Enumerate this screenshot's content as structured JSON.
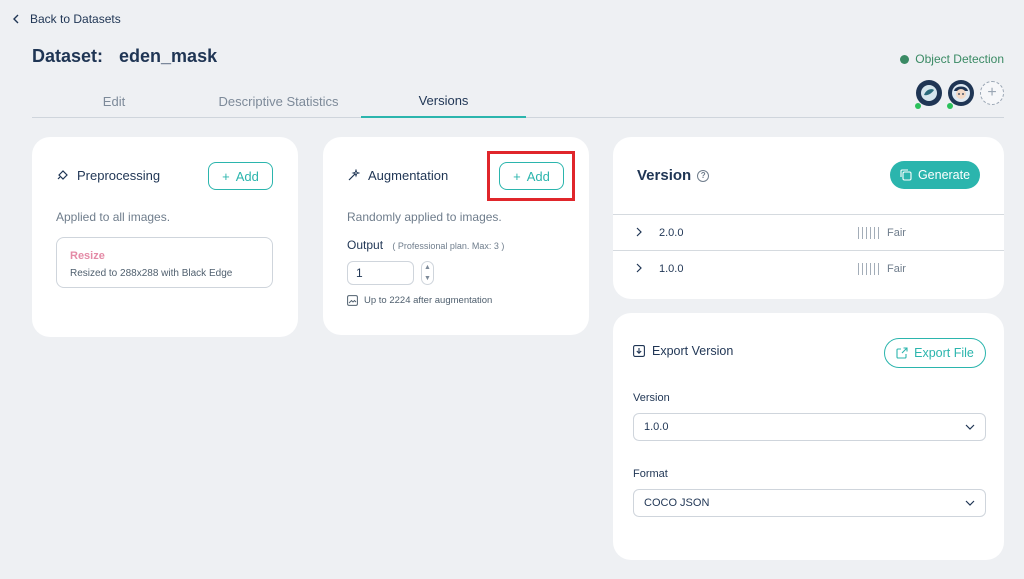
{
  "nav": {
    "back_label": "Back to Datasets"
  },
  "header": {
    "dataset_prefix": "Dataset:",
    "dataset_name": "eden_mask",
    "project_type": "Object Detection",
    "status_color": "#3a8a64"
  },
  "tabs": [
    {
      "label": "Edit",
      "active": false
    },
    {
      "label": "Descriptive Statistics",
      "active": false
    },
    {
      "label": "Versions",
      "active": true
    }
  ],
  "preprocessing": {
    "title": "Preprocessing",
    "add_label": "Add",
    "description": "Applied to all images.",
    "steps": [
      {
        "name": "Resize",
        "detail": "Resized to 288x288 with Black Edge"
      }
    ]
  },
  "augmentation": {
    "title": "Augmentation",
    "add_label": "Add",
    "description": "Randomly applied to images.",
    "output_label": "Output",
    "output_note": "( Professional plan. Max: 3 )",
    "output_value": "1",
    "augment_note": "Up to 2224 after augmentation"
  },
  "versions": {
    "title": "Version",
    "generate_label": "Generate",
    "items": [
      {
        "number": "2.0.0",
        "quality": "Fair"
      },
      {
        "number": "1.0.0",
        "quality": "Fair"
      }
    ]
  },
  "export": {
    "title": "Export Version",
    "export_label": "Export File",
    "version_label": "Version",
    "version_value": "1.0.0",
    "format_label": "Format",
    "format_value": "COCO JSON"
  },
  "colors": {
    "accent": "#2bb5ad",
    "highlight": "#e0262b",
    "step_name": "#e48aa6"
  }
}
